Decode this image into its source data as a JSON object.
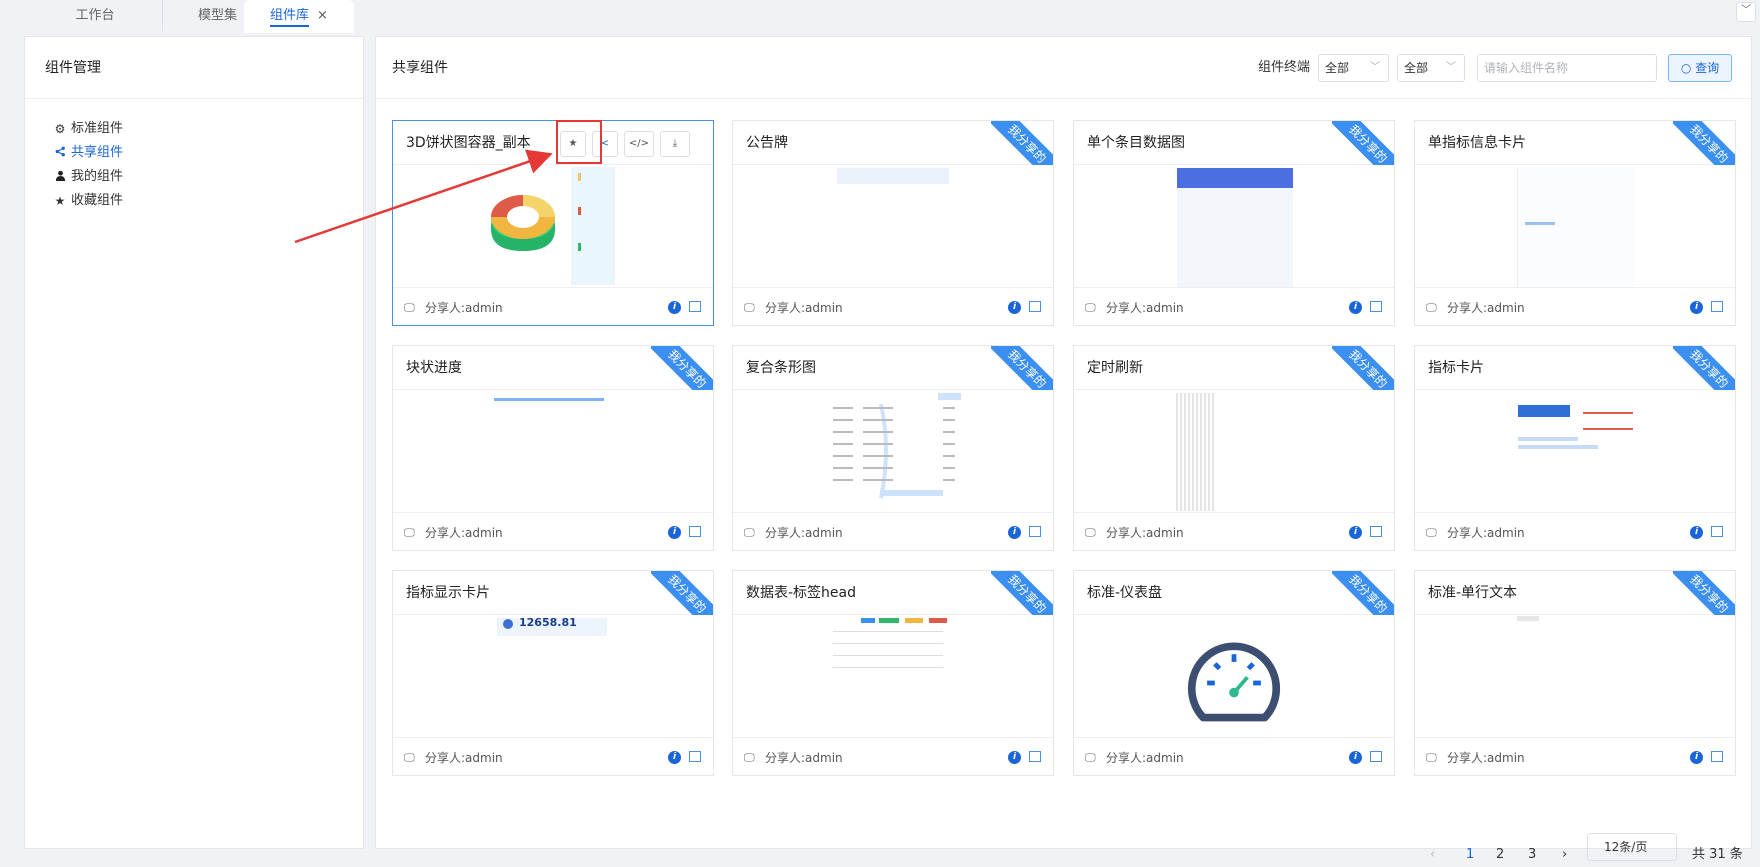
{
  "tabs": [
    {
      "label": "工作台"
    },
    {
      "label": "模型集"
    },
    {
      "label": "组件库"
    }
  ],
  "tab_close": "×",
  "sidebar": {
    "title": "组件管理",
    "items": [
      {
        "label": "标准组件",
        "icon": "gear-icon"
      },
      {
        "label": "共享组件",
        "icon": "share-icon"
      },
      {
        "label": "我的组件",
        "icon": "user-icon"
      },
      {
        "label": "收藏组件",
        "icon": "star-icon"
      }
    ]
  },
  "main": {
    "title": "共享组件",
    "filter_label": "组件终端",
    "select1": "全部",
    "select2": "全部",
    "search_placeholder": "请输入组件名称",
    "query_label": "查询",
    "toolbar": {
      "star": "★",
      "share": "<",
      "code": "</>",
      "download": "⤓"
    },
    "ribbon": "我分享的",
    "cards": [
      {
        "title": "3D饼状图容器_副本",
        "sharer": "分享人:admin"
      },
      {
        "title": "公告牌",
        "sharer": "分享人:admin"
      },
      {
        "title": "单个条目数据图",
        "sharer": "分享人:admin"
      },
      {
        "title": "单指标信息卡片",
        "sharer": "分享人:admin"
      },
      {
        "title": "块状进度",
        "sharer": "分享人:admin"
      },
      {
        "title": "复合条形图",
        "sharer": "分享人:admin"
      },
      {
        "title": "定时刷新",
        "sharer": "分享人:admin"
      },
      {
        "title": "指标卡片",
        "sharer": "分享人:admin"
      },
      {
        "title": "指标显示卡片",
        "sharer": "分享人:admin"
      },
      {
        "title": "数据表-标签head",
        "sharer": "分享人:admin"
      },
      {
        "title": "标准-仪表盘",
        "sharer": "分享人:admin"
      },
      {
        "title": "标准-单行文本",
        "sharer": "分享人:admin"
      }
    ],
    "preview_texts": {
      "indicator_value": "12658.81"
    }
  },
  "pagination": {
    "prev": "‹",
    "pages": [
      "1",
      "2",
      "3"
    ],
    "next": "›",
    "page_size": "12条/页",
    "total": "共 31 条"
  },
  "colors": {
    "accent": "#1a66d8",
    "ribbon": "#3b8ff0",
    "highlight": "#e53935"
  }
}
